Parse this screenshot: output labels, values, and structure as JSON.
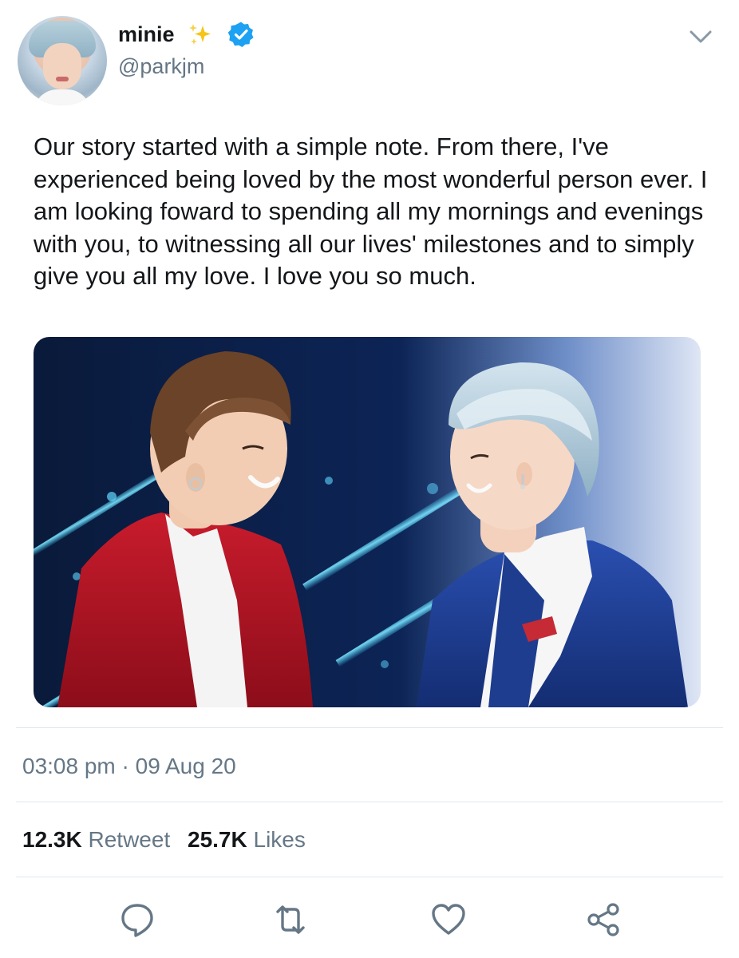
{
  "user": {
    "display_name": "minie",
    "handle": "@parkjm",
    "badge_icons": [
      "sparkles-icon",
      "verified-badge-icon"
    ]
  },
  "tweet": {
    "text": "Our story started with a simple note. From there, I've experienced being loved by the most wonderful person ever. I am looking foward to spending all my mornings and evenings with you, to witnessing all our lives' milestones and to simply give you all my love. I love you so much.",
    "timestamp": "03:08 pm · 09 Aug 20"
  },
  "stats": {
    "retweets_count": "12.3K",
    "retweets_label": "Retweet",
    "likes_count": "25.7K",
    "likes_label": "Likes"
  },
  "actions": [
    "reply-icon",
    "retweet-icon",
    "like-icon",
    "share-icon"
  ],
  "colors": {
    "text": "#14171a",
    "secondary_text": "#657786",
    "verified_blue": "#1da1f2",
    "divider": "#e1e8ed",
    "sparkle_gold": "#f5c518"
  }
}
